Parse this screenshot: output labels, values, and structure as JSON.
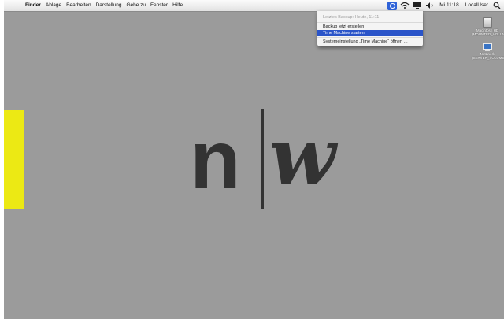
{
  "menubar": {
    "apple_symbol": "",
    "items": [
      "Finder",
      "Ablage",
      "Bearbeiten",
      "Darstellung",
      "Gehe zu",
      "Fenster",
      "Hilfe"
    ],
    "clock": "Mi 11:18",
    "user": "LocalUser"
  },
  "time_machine_menu": {
    "last_backup": "Letztes Backup: Heute, 11:11",
    "backup_now": "Backup jetzt erstellen",
    "start_time_machine": "Time Machine starten",
    "open_preferences": "Systemeinstellung „Time Machine“ öffnen …"
  },
  "desktop": {
    "icons": [
      {
        "name": "hard-disk",
        "line1": "Macintosh HD",
        "line2": "(MOUNTED_VOLUME)",
        "icon": "hard-disk-icon"
      },
      {
        "name": "network-share",
        "line1": "Netzwerk",
        "line2": "(SERVER_VOLUME)",
        "icon": "network-icon"
      }
    ]
  },
  "logo": {
    "left_letter": "n",
    "right_letter": "w",
    "accent_color": "#ece914",
    "mark_color": "#333333"
  },
  "colors": {
    "desktop_background": "#9b9b9b",
    "menu_highlight": "#2a54c9"
  }
}
